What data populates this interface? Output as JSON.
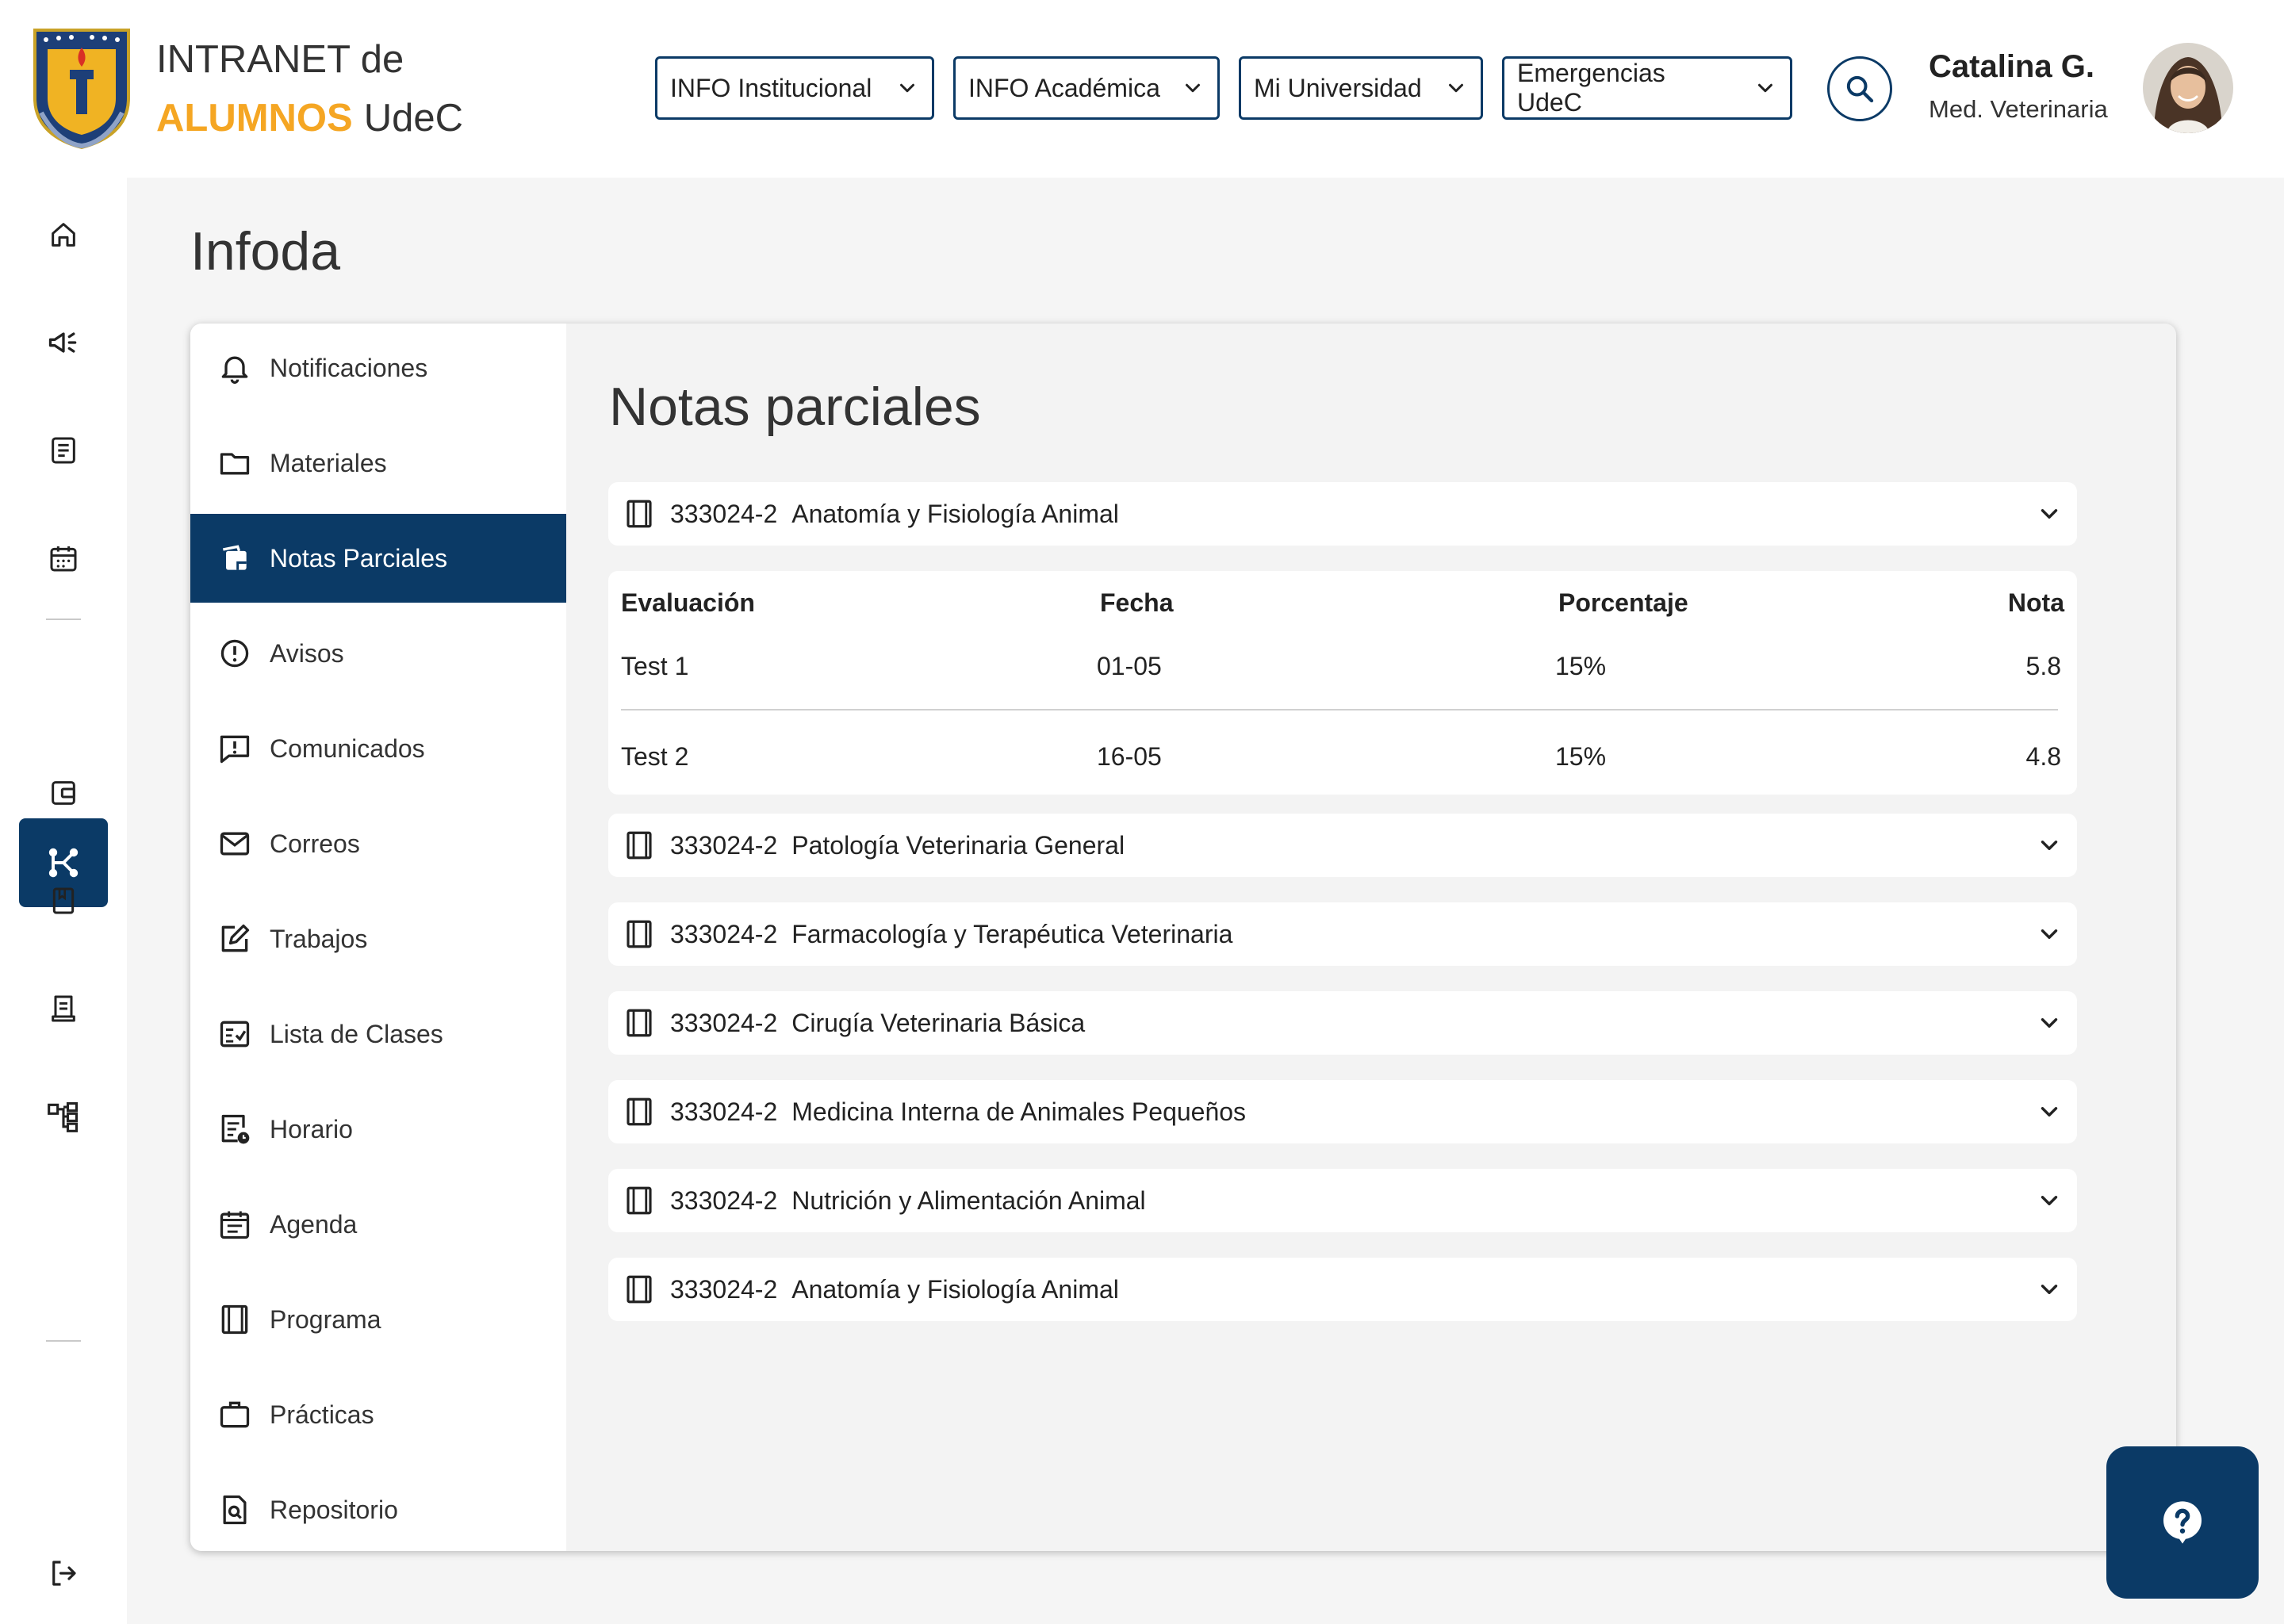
{
  "brand": {
    "line1": "INTRANET de",
    "alumnos": "ALUMNOS",
    "udec": "UdeC"
  },
  "nav": [
    {
      "label": "INFO Institucional"
    },
    {
      "label": "INFO Académica"
    },
    {
      "label": "Mi Universidad"
    },
    {
      "label": "Emergencias UdeC"
    }
  ],
  "user": {
    "name": "Catalina G.",
    "role": "Med. Veterinaria"
  },
  "page_title": "Infoda",
  "menu": [
    {
      "label": "Notificaciones",
      "icon": "bell-icon"
    },
    {
      "label": "Materiales",
      "icon": "folder-icon"
    },
    {
      "label": "Notas Parciales",
      "icon": "notes-icon",
      "active": true
    },
    {
      "label": "Avisos",
      "icon": "alert-circle-icon"
    },
    {
      "label": "Comunicados",
      "icon": "message-alert-icon"
    },
    {
      "label": "Correos",
      "icon": "mail-icon"
    },
    {
      "label": "Trabajos",
      "icon": "edit-square-icon"
    },
    {
      "label": "Lista de Clases",
      "icon": "checklist-icon"
    },
    {
      "label": "Horario",
      "icon": "schedule-icon"
    },
    {
      "label": "Agenda",
      "icon": "calendar-icon"
    },
    {
      "label": "Programa",
      "icon": "book-icon"
    },
    {
      "label": "Prácticas",
      "icon": "briefcase-icon"
    },
    {
      "label": "Repositorio",
      "icon": "file-search-icon"
    }
  ],
  "content": {
    "title": "Notas parciales",
    "courses": [
      {
        "code": "333024-2",
        "name": "Anatomía y Fisiología Animal",
        "expanded": true
      },
      {
        "code": "333024-2",
        "name": "Patología Veterinaria General"
      },
      {
        "code": "333024-2",
        "name": "Farmacología y Terapéutica Veterinaria"
      },
      {
        "code": "333024-2",
        "name": "Cirugía Veterinaria Básica"
      },
      {
        "code": "333024-2",
        "name": "Medicina Interna de Animales Pequeños"
      },
      {
        "code": "333024-2",
        "name": "Nutrición y Alimentación Animal"
      },
      {
        "code": "333024-2",
        "name": "Anatomía y Fisiología Animal"
      }
    ],
    "grades": {
      "headers": {
        "evaluacion": "Evaluación",
        "fecha": "Fecha",
        "porcentaje": "Porcentaje",
        "nota": "Nota"
      },
      "rows": [
        {
          "evaluacion": "Test 1",
          "fecha": "01-05",
          "porcentaje": "15%",
          "nota": "5.8"
        },
        {
          "evaluacion": "Test 2",
          "fecha": "16-05",
          "porcentaje": "15%",
          "nota": "4.8"
        }
      ]
    }
  },
  "colors": {
    "primary": "#0b3a66",
    "accent": "#f5a623",
    "background": "#f5f5f5"
  }
}
